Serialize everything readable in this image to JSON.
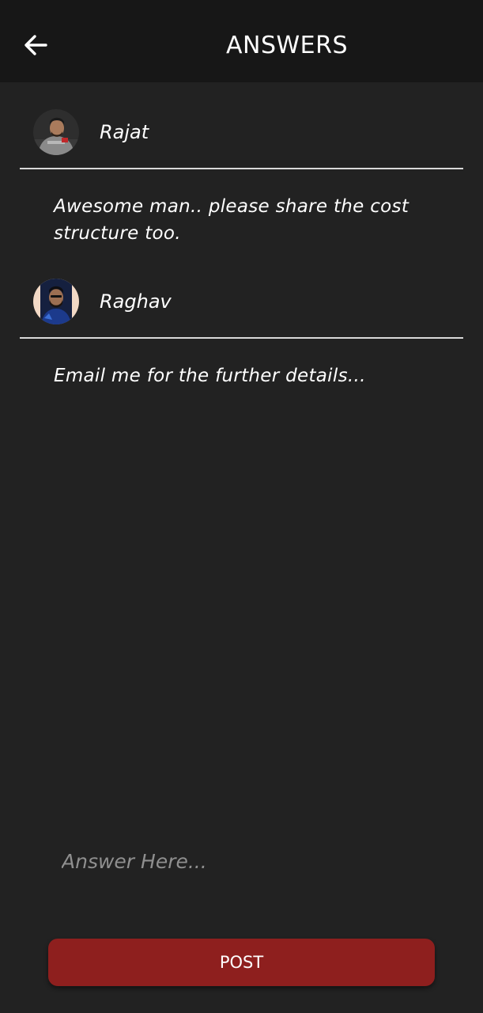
{
  "header": {
    "title": "ANSWERS",
    "back_icon": "arrow-left-icon"
  },
  "answers": [
    {
      "author": "Rajat",
      "avatar_icon": "user-photo-avatar",
      "text": "Awesome man.. please share the cost structure too."
    },
    {
      "author": "Raghav",
      "avatar_icon": "user-photo-avatar",
      "text": "Email me for the further details..."
    }
  ],
  "composer": {
    "placeholder": "Answer Here...",
    "value": "",
    "post_label": "POST"
  },
  "colors": {
    "background": "#222222",
    "app_bar": "#171717",
    "accent": "#8e1f1e",
    "text": "#ffffff",
    "placeholder": "#8f8f8f",
    "divider": "#d9d9d9"
  }
}
